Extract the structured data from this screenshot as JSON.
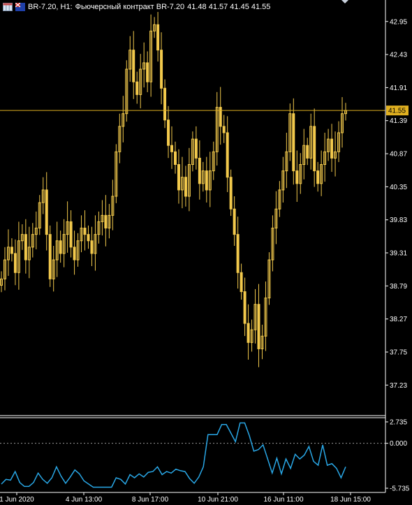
{
  "header": {
    "symbol_label": "BR-7.20, H1:",
    "description": "Фьючерсный контракт BR-7.20",
    "ohlc": "41.48 41.57 41.45 41.55"
  },
  "price_panel": {
    "current_price_label": "41.55",
    "current_price": 41.55,
    "colors": {
      "candle": "#f2c94c",
      "grid": "#ffffff",
      "price_line": "#e0b020",
      "badge_bg": "#e0b020"
    }
  },
  "indicator_panel": {
    "zero_label": "0.000",
    "colors": {
      "line": "#29a7e6"
    }
  },
  "chart_data": [
    {
      "type": "line",
      "title": "",
      "xlabel": "",
      "ylabel": "",
      "ylim": [
        36.75,
        43.2
      ],
      "yticks": [
        42.95,
        42.43,
        41.91,
        41.39,
        40.87,
        40.35,
        39.83,
        39.31,
        38.79,
        38.27,
        37.75,
        37.23
      ],
      "x_ticks": [
        "1 Jun 2020",
        "4 Jun 13:00",
        "8 Jun 17:00",
        "10 Jun 21:00",
        "16 Jun 11:00",
        "18 Jun 15:00"
      ],
      "grid": false,
      "series": [
        {
          "values": [
            38.9,
            39.2,
            39.4,
            39.3,
            39.0,
            39.5,
            39.6,
            39.2,
            39.4,
            39.6,
            39.7,
            40.1,
            40.3,
            39.6,
            38.9,
            39.2,
            39.5,
            39.3,
            39.6,
            39.8,
            39.4,
            39.2,
            39.5,
            39.7,
            39.6,
            39.5,
            39.3,
            39.6,
            39.8,
            39.9,
            39.7,
            39.9,
            40.2,
            40.9,
            41.3,
            41.5,
            42.2,
            42.5,
            42.0,
            41.8,
            42.2,
            42.3,
            42.0,
            42.8,
            42.9,
            42.5,
            41.9,
            41.4,
            41.0,
            40.9,
            40.7,
            40.3,
            40.5,
            40.2,
            40.7,
            41.1,
            40.8,
            40.4,
            40.6,
            40.3,
            40.6,
            40.9,
            41.6,
            41.3,
            41.2,
            40.5,
            40.0,
            39.6,
            39.0,
            38.7,
            38.2,
            37.9,
            38.1,
            38.5,
            37.8,
            38.0,
            38.6,
            39.2,
            39.7,
            40.0,
            40.3,
            40.6,
            40.9,
            41.5,
            40.6,
            40.4,
            40.7,
            41.0,
            40.8,
            41.3,
            40.6,
            40.4,
            40.7,
            40.9,
            41.1,
            40.8,
            40.9,
            41.2,
            41.5,
            41.55
          ]
        }
      ]
    },
    {
      "type": "line",
      "title": "",
      "ylim": [
        -5.735,
        2.735
      ],
      "yticks": [
        2.735,
        0.0,
        -5.735
      ],
      "grid": false,
      "series": [
        {
          "values": [
            -5.2,
            -4.6,
            -4.7,
            -3.6,
            -5.0,
            -5.5,
            -5.5,
            -5.0,
            -3.8,
            -4.6,
            -5.1,
            -4.4,
            -3.0,
            -4.2,
            -5.1,
            -4.3,
            -3.4,
            -3.9,
            -4.8,
            -5.2,
            -5.6,
            -5.6,
            -5.6,
            -5.6,
            -5.6,
            -4.4,
            -4.6,
            -5.2,
            -4.0,
            -4.4,
            -3.9,
            -4.3,
            -3.7,
            -3.6,
            -3.0,
            -4.0,
            -3.6,
            -3.8,
            -3.3,
            -3.5,
            -3.6,
            -4.5,
            -5.1,
            -4.3,
            -3.0,
            1.1,
            1.1,
            1.1,
            2.4,
            2.4,
            1.3,
            0.2,
            2.6,
            2.6,
            1.0,
            -1.0,
            -0.8,
            -0.2,
            -2.0,
            -3.8,
            -1.9,
            -3.9,
            -2.0,
            -3.2,
            -1.4,
            -2.0,
            -1.5,
            -0.4,
            -2.3,
            -2.8,
            -0.2,
            -2.8,
            -2.6,
            -3.2,
            -4.4,
            -3.0
          ]
        }
      ]
    }
  ]
}
